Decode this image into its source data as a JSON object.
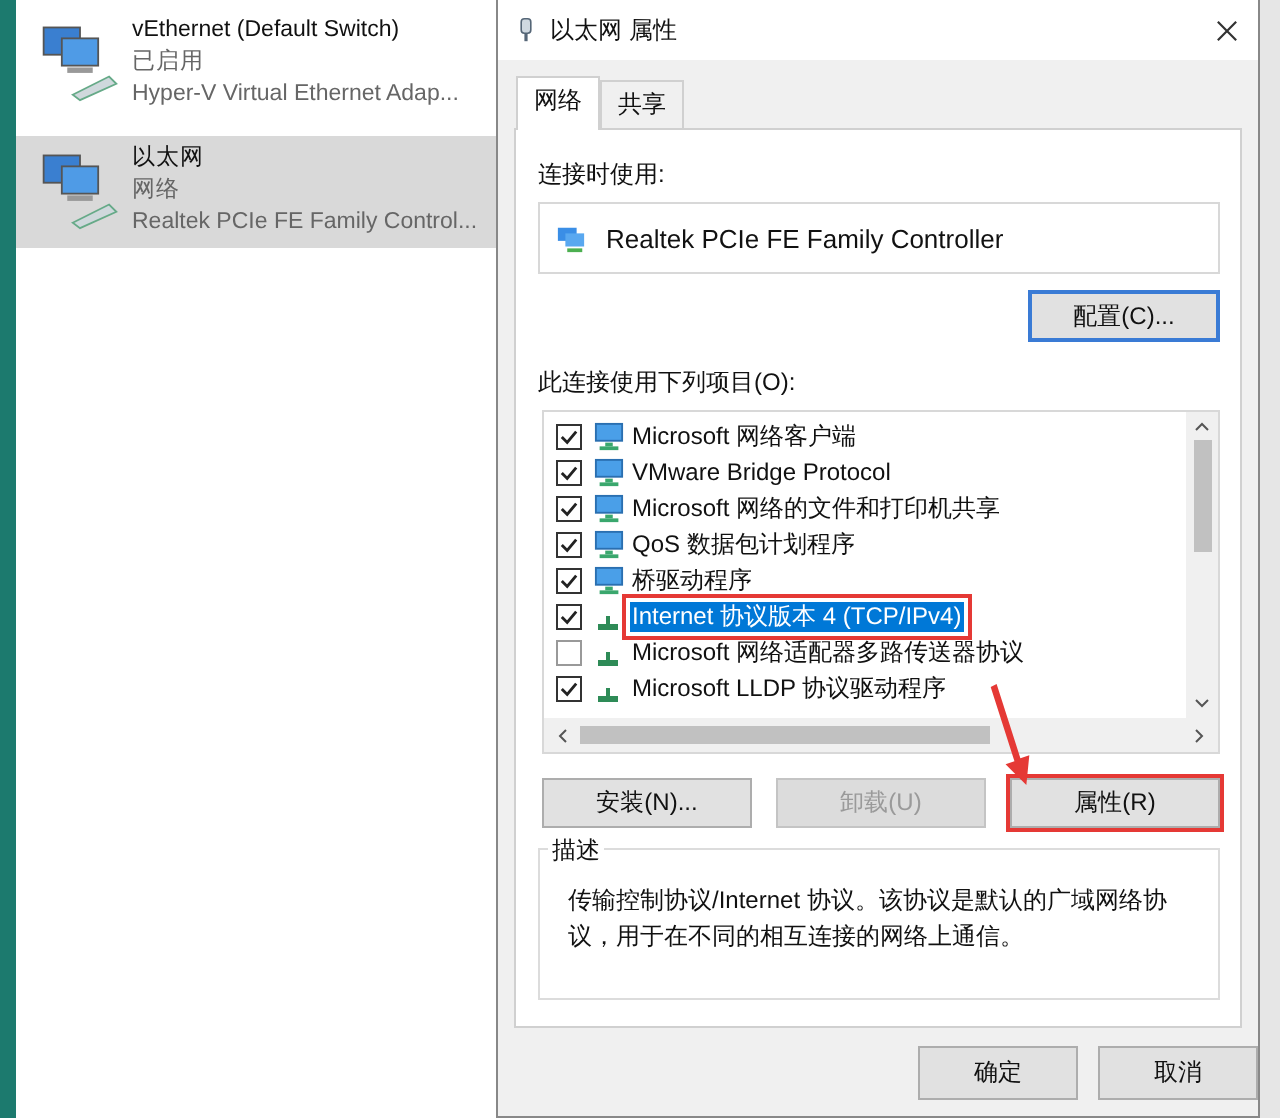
{
  "adapters": [
    {
      "name": "vEthernet (Default Switch)",
      "status": "已启用",
      "device": "Hyper-V Virtual Ethernet Adap...",
      "selected": false
    },
    {
      "name": "以太网",
      "status": "网络",
      "device": "Realtek PCIe FE Family Control...",
      "selected": true
    }
  ],
  "dialog": {
    "title": "以太网 属性",
    "tabs": [
      {
        "label": "网络",
        "selected": true
      },
      {
        "label": "共享",
        "selected": false
      }
    ],
    "connect_using_label": "连接时使用:",
    "adapter": "Realtek PCIe FE Family Controller",
    "configure_button": "配置(C)...",
    "items_label": "此连接使用下列项目(O):",
    "components": [
      {
        "kind": "client",
        "label": "Microsoft 网络客户端",
        "checked": true,
        "selected": false,
        "highlighted": false
      },
      {
        "kind": "client",
        "label": "VMware Bridge Protocol",
        "checked": true,
        "selected": false,
        "highlighted": false
      },
      {
        "kind": "client",
        "label": "Microsoft 网络的文件和打印机共享",
        "checked": true,
        "selected": false,
        "highlighted": false
      },
      {
        "kind": "client",
        "label": "QoS 数据包计划程序",
        "checked": true,
        "selected": false,
        "highlighted": false
      },
      {
        "kind": "client",
        "label": "桥驱动程序",
        "checked": true,
        "selected": false,
        "highlighted": false
      },
      {
        "kind": "protocol",
        "label": "Internet 协议版本 4 (TCP/IPv4)",
        "checked": true,
        "selected": true,
        "highlighted": true
      },
      {
        "kind": "protocol",
        "label": "Microsoft 网络适配器多路传送器协议",
        "checked": false,
        "selected": false,
        "highlighted": false
      },
      {
        "kind": "protocol",
        "label": "Microsoft LLDP 协议驱动程序",
        "checked": true,
        "selected": false,
        "highlighted": false
      }
    ],
    "action_buttons": [
      {
        "label": "安装(N)...",
        "disabled": false,
        "highlighted": false
      },
      {
        "label": "卸载(U)",
        "disabled": true,
        "highlighted": false
      },
      {
        "label": "属性(R)",
        "disabled": false,
        "highlighted": true
      }
    ],
    "description_title": "描述",
    "description": "传输控制协议/Internet 协议。该协议是默认的广域网络协议，用于在不同的相互连接的网络上通信。",
    "footer_buttons": [
      "确定",
      "取消"
    ]
  }
}
